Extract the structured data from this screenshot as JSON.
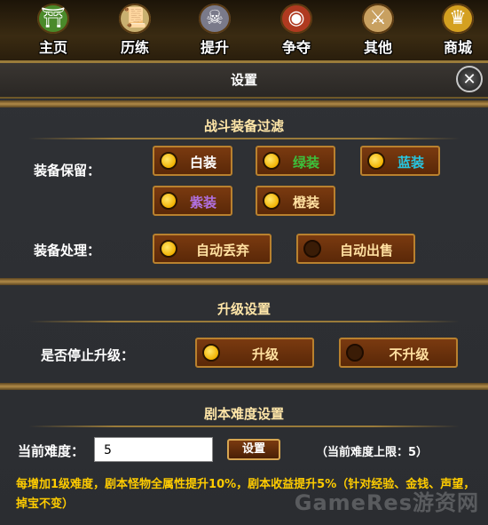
{
  "nav": [
    {
      "label": "主页",
      "icon": "bamboo-hat-icon",
      "color": "#4a8a2a"
    },
    {
      "label": "历练",
      "icon": "scroll-icon",
      "color": "#c9b070"
    },
    {
      "label": "提升",
      "icon": "mask-icon",
      "color": "#7a7a8a"
    },
    {
      "label": "争夺",
      "icon": "war-drum-icon",
      "color": "#b03a20"
    },
    {
      "label": "其他",
      "icon": "sword-scroll-icon",
      "color": "#c8a060"
    },
    {
      "label": "商城",
      "icon": "treasure-icon",
      "color": "#d4a020"
    }
  ],
  "dialog": {
    "title": "设置",
    "close_label": "✕",
    "filter": {
      "title": "战斗装备过滤",
      "keep_label": "装备保留：",
      "keep_options": [
        {
          "label": "白装",
          "color": "#ffffff",
          "checked": true
        },
        {
          "label": "绿装",
          "color": "#3cc13c",
          "checked": true
        },
        {
          "label": "蓝装",
          "color": "#27c5e0",
          "checked": true
        },
        {
          "label": "紫装",
          "color": "#b070e0",
          "checked": true
        },
        {
          "label": "橙装",
          "color": "#ffe0a0",
          "checked": true
        }
      ],
      "handle_label": "装备处理：",
      "handle_options": [
        {
          "label": "自动丢弃",
          "color": "#ffe0a0",
          "checked": true
        },
        {
          "label": "自动出售",
          "color": "#ffe0a0",
          "checked": false
        }
      ]
    },
    "upgrade": {
      "title": "升级设置",
      "stop_label": "是否停止升级：",
      "options": [
        {
          "label": "升级",
          "color": "#ffe0a0",
          "checked": true
        },
        {
          "label": "不升级",
          "color": "#ffe0a0",
          "checked": false
        }
      ]
    },
    "difficulty": {
      "title": "剧本难度设置",
      "current_label": "当前难度：",
      "value": "5",
      "set_button": "设置",
      "limit_text": "（当前难度上限：5）",
      "note": "每增加1级难度，剧本怪物全属性提升10%，剧本收益提升5%（针对经验、金钱、声望，掉宝不变）"
    }
  },
  "watermark": "GameRes游资网"
}
